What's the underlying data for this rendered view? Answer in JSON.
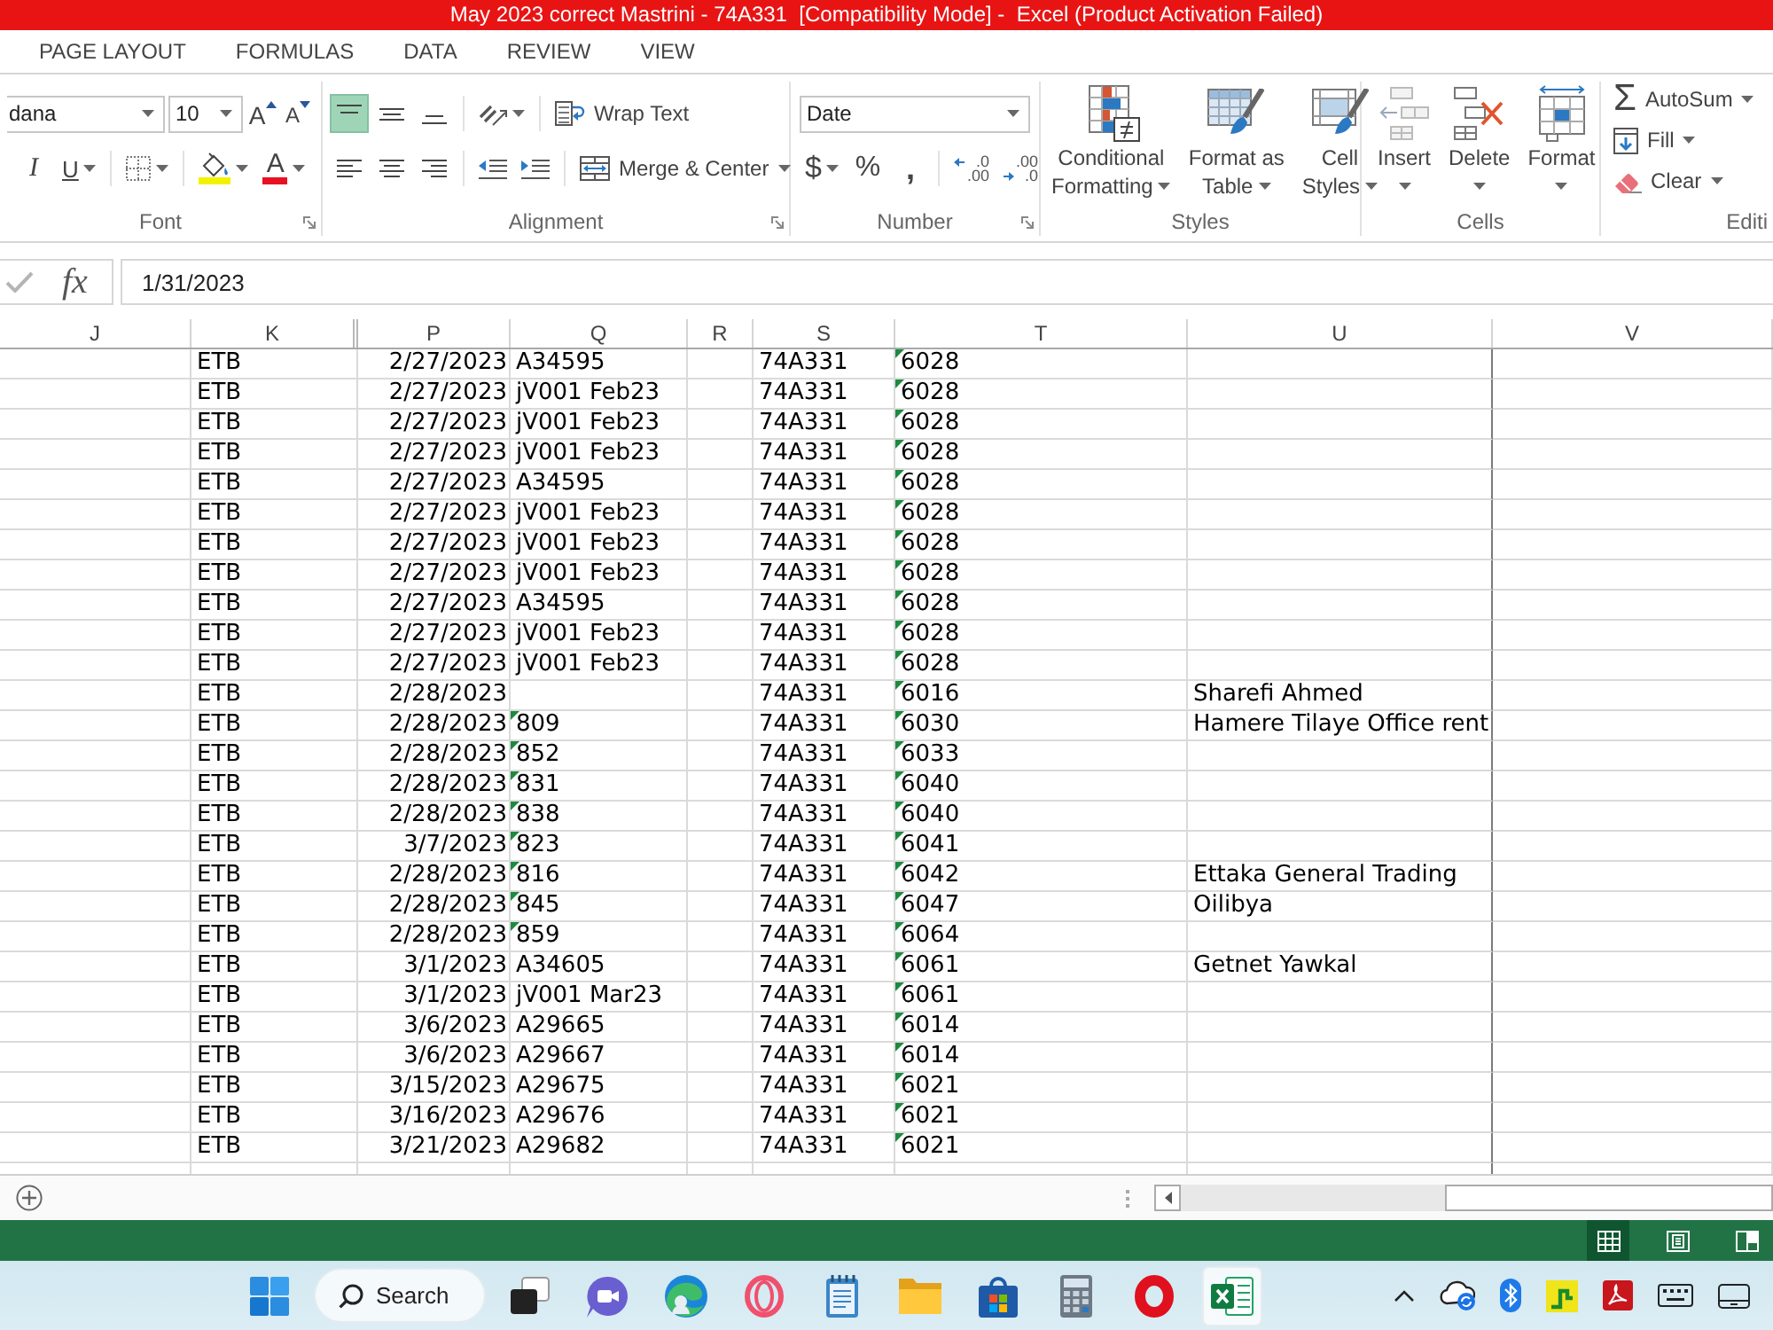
{
  "window": {
    "title": "May 2023 correct Mastrini - 74A331  [Compatibility Mode] -  Excel (Product Activation Failed)"
  },
  "ribbon_tabs": [
    {
      "label": "PAGE LAYOUT",
      "selected": false
    },
    {
      "label": "FORMULAS",
      "selected": false
    },
    {
      "label": "DATA",
      "selected": false
    },
    {
      "label": "REVIEW",
      "selected": false
    },
    {
      "label": "VIEW",
      "selected": false
    }
  ],
  "ribbon": {
    "groups": [
      {
        "label": "Font",
        "launcher": true,
        "rows": [
          [
            [
              {
                "kind": "font-name",
                "value": "dana",
                "dropdown": true
              },
              {
                "kind": "font-size",
                "value": "10",
                "dropdown": true
              },
              {
                "kind": "grow-font",
                "label": "A"
              },
              {
                "kind": "shrink-font",
                "label": "A"
              }
            ]
          ],
          [
            [
              {
                "kind": "italic",
                "label": "I",
                "selected": false
              },
              {
                "kind": "underline",
                "label": "U",
                "selected": false,
                "dropdown": true
              }
            ],
            [
              {
                "kind": "borders",
                "dropdown": true
              }
            ],
            [
              {
                "kind": "fill-color",
                "dropdown": true
              },
              {
                "kind": "font-color",
                "label": "A",
                "dropdown": true
              }
            ]
          ]
        ]
      },
      {
        "label": "Alignment",
        "launcher": true,
        "rows": [
          [
            [
              {
                "kind": "align-top",
                "selected": true
              },
              {
                "kind": "align-middle",
                "selected": false
              },
              {
                "kind": "align-bottom",
                "selected": false
              }
            ],
            [
              {
                "kind": "orientation",
                "dropdown": true
              }
            ],
            [
              {
                "kind": "wrap-text",
                "label": "Wrap Text",
                "selected": false
              }
            ]
          ],
          [
            [
              {
                "kind": "align-left",
                "selected": false
              },
              {
                "kind": "align-center",
                "selected": false
              },
              {
                "kind": "align-right",
                "selected": false
              }
            ],
            [
              {
                "kind": "decrease-indent"
              },
              {
                "kind": "increase-indent"
              }
            ],
            [
              {
                "kind": "merge-center",
                "label": "Merge & Center",
                "selected": false,
                "dropdown": true
              }
            ]
          ]
        ]
      },
      {
        "label": "Number",
        "launcher": true,
        "rows": [
          [
            [
              {
                "kind": "number-format",
                "value": "Date",
                "dropdown": true
              }
            ]
          ],
          [
            [
              {
                "kind": "currency",
                "label": "$",
                "dropdown": true
              },
              {
                "kind": "percent",
                "label": "%"
              },
              {
                "kind": "comma",
                "label": ","
              }
            ],
            [
              {
                "kind": "increase-decimal",
                "top": ".0",
                "bottom": ".00"
              },
              {
                "kind": "decrease-decimal",
                "top": ".00",
                "bottom": ".0"
              }
            ]
          ]
        ]
      },
      {
        "label": "Styles",
        "large": [
          {
            "kind": "conditional-formatting",
            "lines": [
              "Conditional",
              "Formatting"
            ],
            "dropdown": true
          },
          {
            "kind": "format-as-table",
            "lines": [
              "Format as",
              "Table"
            ],
            "dropdown": true
          },
          {
            "kind": "cell-styles",
            "lines": [
              "Cell",
              "Styles"
            ],
            "dropdown": true
          }
        ]
      },
      {
        "label": "Cells",
        "large": [
          {
            "kind": "insert",
            "lines": [
              "Insert"
            ],
            "dropdown": true
          },
          {
            "kind": "delete",
            "lines": [
              "Delete"
            ],
            "dropdown": true
          },
          {
            "kind": "format",
            "lines": [
              "Format"
            ],
            "dropdown": true
          }
        ]
      },
      {
        "label": "Editi",
        "stack": [
          {
            "kind": "autosum",
            "symbol": "Σ",
            "label": "AutoSum",
            "dropdown": true
          },
          {
            "kind": "fill",
            "label": "Fill",
            "dropdown": true
          },
          {
            "kind": "clear",
            "label": "Clear",
            "dropdown": true
          }
        ]
      }
    ]
  },
  "formula_bar": {
    "enter_disabled": true,
    "function_label": "fx",
    "value": "1/31/2023"
  },
  "sheet": {
    "columns": [
      "J",
      "K",
      "P",
      "Q",
      "R",
      "S",
      "T",
      "U",
      "V"
    ],
    "rows": [
      {
        "cells": [
          null,
          "ETB",
          "2/27/2023",
          "A34595",
          null,
          "74A331",
          "6028"
        ],
        "q_flagged": false,
        "t_flagged": true
      },
      {
        "cells": [
          null,
          "ETB",
          "2/27/2023",
          "jV001 Feb23",
          null,
          "74A331",
          "6028"
        ],
        "q_flagged": false,
        "t_flagged": true
      },
      {
        "cells": [
          null,
          "ETB",
          "2/27/2023",
          "jV001 Feb23",
          null,
          "74A331",
          "6028"
        ],
        "q_flagged": false,
        "t_flagged": true
      },
      {
        "cells": [
          null,
          "ETB",
          "2/27/2023",
          "jV001 Feb23",
          null,
          "74A331",
          "6028"
        ],
        "q_flagged": false,
        "t_flagged": true
      },
      {
        "cells": [
          null,
          "ETB",
          "2/27/2023",
          "A34595",
          null,
          "74A331",
          "6028"
        ],
        "q_flagged": false,
        "t_flagged": true
      },
      {
        "cells": [
          null,
          "ETB",
          "2/27/2023",
          "jV001 Feb23",
          null,
          "74A331",
          "6028"
        ],
        "q_flagged": false,
        "t_flagged": true
      },
      {
        "cells": [
          null,
          "ETB",
          "2/27/2023",
          "jV001 Feb23",
          null,
          "74A331",
          "6028"
        ],
        "q_flagged": false,
        "t_flagged": true
      },
      {
        "cells": [
          null,
          "ETB",
          "2/27/2023",
          "jV001 Feb23",
          null,
          "74A331",
          "6028"
        ],
        "q_flagged": false,
        "t_flagged": true
      },
      {
        "cells": [
          null,
          "ETB",
          "2/27/2023",
          "A34595",
          null,
          "74A331",
          "6028"
        ],
        "q_flagged": false,
        "t_flagged": true
      },
      {
        "cells": [
          null,
          "ETB",
          "2/27/2023",
          "jV001 Feb23",
          null,
          "74A331",
          "6028"
        ],
        "q_flagged": false,
        "t_flagged": true
      },
      {
        "cells": [
          null,
          "ETB",
          "2/27/2023",
          "jV001 Feb23",
          null,
          "74A331",
          "6028"
        ],
        "q_flagged": false,
        "t_flagged": true
      },
      {
        "cells": [
          null,
          "ETB",
          "2/28/2023",
          null,
          null,
          "74A331",
          "6016",
          "Sharefi Ahmed"
        ],
        "q_flagged": false,
        "t_flagged": true
      },
      {
        "cells": [
          null,
          "ETB",
          "2/28/2023",
          "809",
          null,
          "74A331",
          "6030",
          "Hamere Tilaye Office rent"
        ],
        "q_flagged": true,
        "t_flagged": true
      },
      {
        "cells": [
          null,
          "ETB",
          "2/28/2023",
          "852",
          null,
          "74A331",
          "6033"
        ],
        "q_flagged": true,
        "t_flagged": true
      },
      {
        "cells": [
          null,
          "ETB",
          "2/28/2023",
          "831",
          null,
          "74A331",
          "6040"
        ],
        "q_flagged": true,
        "t_flagged": true
      },
      {
        "cells": [
          null,
          "ETB",
          "2/28/2023",
          "838",
          null,
          "74A331",
          "6040"
        ],
        "q_flagged": true,
        "t_flagged": true
      },
      {
        "cells": [
          null,
          "ETB",
          "3/7/2023",
          "823",
          null,
          "74A331",
          "6041"
        ],
        "q_flagged": true,
        "t_flagged": true
      },
      {
        "cells": [
          null,
          "ETB",
          "2/28/2023",
          "816",
          null,
          "74A331",
          "6042",
          "Ettaka General Trading"
        ],
        "q_flagged": true,
        "t_flagged": true
      },
      {
        "cells": [
          null,
          "ETB",
          "2/28/2023",
          "845",
          null,
          "74A331",
          "6047",
          "Oilibya"
        ],
        "q_flagged": true,
        "t_flagged": true
      },
      {
        "cells": [
          null,
          "ETB",
          "2/28/2023",
          "859",
          null,
          "74A331",
          "6064"
        ],
        "q_flagged": true,
        "t_flagged": true
      },
      {
        "cells": [
          null,
          "ETB",
          "3/1/2023",
          "A34605",
          null,
          "74A331",
          "6061",
          "Getnet Yawkal"
        ],
        "q_flagged": false,
        "t_flagged": true
      },
      {
        "cells": [
          null,
          "ETB",
          "3/1/2023",
          "jV001 Mar23",
          null,
          "74A331",
          "6061"
        ],
        "q_flagged": false,
        "t_flagged": true
      },
      {
        "cells": [
          null,
          "ETB",
          "3/6/2023",
          "A29665",
          null,
          "74A331",
          "6014"
        ],
        "q_flagged": false,
        "t_flagged": true
      },
      {
        "cells": [
          null,
          "ETB",
          "3/6/2023",
          "A29667",
          null,
          "74A331",
          "6014"
        ],
        "q_flagged": false,
        "t_flagged": true
      },
      {
        "cells": [
          null,
          "ETB",
          "3/15/2023",
          "A29675",
          null,
          "74A331",
          "6021"
        ],
        "q_flagged": false,
        "t_flagged": true
      },
      {
        "cells": [
          null,
          "ETB",
          "3/16/2023",
          "A29676",
          null,
          "74A331",
          "6021"
        ],
        "q_flagged": false,
        "t_flagged": true
      },
      {
        "cells": [
          null,
          "ETB",
          "3/21/2023",
          "A29682",
          null,
          "74A331",
          "6021"
        ],
        "q_flagged": false,
        "t_flagged": true
      }
    ]
  },
  "status_bar": {
    "views": [
      {
        "kind": "normal",
        "selected": true
      },
      {
        "kind": "page-layout",
        "selected": false
      },
      {
        "kind": "page-break",
        "selected": false
      }
    ]
  },
  "taskbar": {
    "apps": [
      {
        "kind": "start",
        "active": false
      },
      {
        "kind": "search",
        "label": "Search"
      },
      {
        "kind": "task-view",
        "active": false
      },
      {
        "kind": "chat",
        "active": false
      },
      {
        "kind": "edge",
        "active": false
      },
      {
        "kind": "opera-gx",
        "active": false
      },
      {
        "kind": "notepad",
        "active": false
      },
      {
        "kind": "explorer",
        "active": false
      },
      {
        "kind": "store",
        "active": false
      },
      {
        "kind": "calculator",
        "active": false
      },
      {
        "kind": "opera",
        "active": false
      },
      {
        "kind": "excel",
        "active": true
      }
    ]
  }
}
